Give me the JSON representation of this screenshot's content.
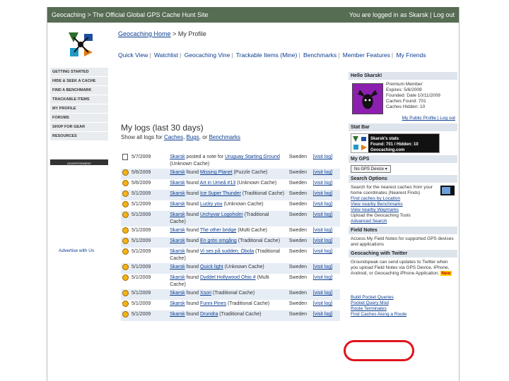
{
  "window": {
    "title": "Geocaching > The Official Global GPS Cache Hunt Site",
    "login_status": "You are logged in as Skarsk | Log out"
  },
  "breadcrumb": {
    "home": "Geocaching Home",
    "sep": ">",
    "current": "My Profile"
  },
  "topnav": [
    "Quick View",
    "Watchlist",
    "Geocaching Vine",
    "Trackable Items (Mine)",
    "Benchmarks",
    "Member Features",
    "My Friends"
  ],
  "sidebar": [
    "GETTING STARTED",
    "HIDE & SEEK A CACHE",
    "FIND A BENCHMARK",
    "TRACKABLE ITEMS",
    "MY PROFILE",
    "FORUMS",
    "SHOP FOR GEAR",
    "RESOURCES"
  ],
  "ad": {
    "header": "ADVERTISEMENT",
    "link": "Advertise with Us"
  },
  "main": {
    "title": "My logs (last 30 days)",
    "show_all_prefix": "Show all logs for",
    "show_caches": "Caches",
    "show_bugs": "Bugs",
    "show_or": "or",
    "show_benchmarks": "Benchmarks"
  },
  "logs": [
    {
      "icon": "note",
      "date": "5/7/2009",
      "user": "Skarsk",
      "action": "posted a note for",
      "cache": "Uruguay Starting Ground",
      "type": "(Unknown Cache)",
      "country": "Sweden",
      "visit": "[visit log]"
    },
    {
      "icon": "smile",
      "date": "5/6/2009",
      "user": "Skarsk",
      "action": "found",
      "cache": "Missing Planet",
      "type": "(Puzzle Cache)",
      "country": "Sweden",
      "visit": "[visit log]"
    },
    {
      "icon": "smile",
      "date": "5/6/2009",
      "user": "Skarsk",
      "action": "found",
      "cache": "Art in Umeå #13",
      "type": "(Unknown Cache)",
      "country": "Sweden",
      "visit": "[visit log]"
    },
    {
      "icon": "smile",
      "date": "5/1/2009",
      "user": "Skarsk",
      "action": "found",
      "cache": "Ice Super Thunder",
      "type": "(Traditional Cache)",
      "country": "Sweden",
      "visit": "[visit log]"
    },
    {
      "icon": "smile",
      "date": "5/1/2009",
      "user": "Skarsk",
      "action": "found",
      "cache": "Lucky you",
      "type": "(Unknown Cache)",
      "country": "Sweden",
      "visit": "[visit log]"
    },
    {
      "icon": "smile",
      "date": "5/1/2009",
      "user": "Skarsk",
      "action": "found",
      "cache": "Urchyvar Logoholm",
      "type": "(Traditional Cache)",
      "country": "Sweden",
      "visit": "[visit log]"
    },
    {
      "icon": "smile",
      "date": "5/1/2009",
      "user": "Skarsk",
      "action": "found",
      "cache": "The other bridge",
      "type": "(Multi Cache)",
      "country": "Sweden",
      "visit": "[visit log]"
    },
    {
      "icon": "smile",
      "date": "5/1/2009",
      "user": "Skarsk",
      "action": "found",
      "cache": "En grön omgång",
      "type": "(Traditional Cache)",
      "country": "Sweden",
      "visit": "[visit log]"
    },
    {
      "icon": "smile",
      "date": "5/1/2009",
      "user": "Skarsk",
      "action": "found",
      "cache": "Vi ses på sudden, Öbola",
      "type": "(Traditional Cache)",
      "country": "Sweden",
      "visit": "[visit log]"
    },
    {
      "icon": "smile",
      "date": "5/1/2009",
      "user": "Skarsk",
      "action": "found",
      "cache": "Quick light",
      "type": "(Unknown Cache)",
      "country": "Sweden",
      "visit": "[visit log]"
    },
    {
      "icon": "smile",
      "date": "5/1/2009",
      "user": "Skarsk",
      "action": "found",
      "cache": "Dyddel Hollywood Ohio #",
      "type": "(Multi Cache)",
      "country": "Sweden",
      "visit": "[visit log]"
    },
    {
      "icon": "smile",
      "date": "5/1/2009",
      "user": "Skarsk",
      "action": "found",
      "cache": "Xsori",
      "type": "(Traditional Cache)",
      "country": "Sweden",
      "visit": "[visit log]"
    },
    {
      "icon": "smile",
      "date": "5/1/2009",
      "user": "Skarsk",
      "action": "found",
      "cache": "Funni Pines",
      "type": "(Traditional Cache)",
      "country": "Sweden",
      "visit": "[visit log]"
    },
    {
      "icon": "smile",
      "date": "5/1/2009",
      "user": "Skarsk",
      "action": "found",
      "cache": "Drundra",
      "type": "(Traditional Cache)",
      "country": "Sweden",
      "visit": "[visit log]"
    }
  ],
  "right": {
    "hello": "Hello Skarsk!",
    "profile_lines": [
      "Premium Member",
      "Expires: 5/6/2009",
      "Founded: Date 10/11/2009",
      "Caches Found: 701",
      "Caches Hidden: 10"
    ],
    "profile_links": "My Public Profile | Log out",
    "stat_bar_head": "Stat Bar",
    "stat_bar_title": "Skarsk's stats",
    "stat_bar_counts": "Found: 701 / Hidden: 10",
    "stat_bar_sub": "Geocaching.com",
    "mygps_head": "My GPS",
    "mygps_select": "No GPS Device",
    "search_head": "Search Options",
    "search_body": "Search for the nearest caches from your home coordinates (Nearest Finds)",
    "search_links": [
      "Find caches by Location",
      "View nearby Benchmarks",
      "View nearby Waymarks"
    ],
    "search_extra": "Upload the Geocaching Tools",
    "advanced": "Advanced Search",
    "field_head": "Field Notes",
    "field_body": "Access My Field Notes for supported GPS devices and applications",
    "twitter_head": "Geocaching with Twitter",
    "twitter_body": "Groundspeak can send updates to Twitter when you upload Field Notes via GPS Device, iPhone, Android, or Geocaching iPhone Application.",
    "twitter_new": "New",
    "bottom_links": [
      "Build Pocket Queries",
      "Pocket Query Mod",
      "Route Terminates",
      "Find Caches Along a Route"
    ]
  },
  "colors": {
    "titlebar": "#566c53",
    "link": "#0b3d91",
    "highlight": "#e0141b"
  }
}
